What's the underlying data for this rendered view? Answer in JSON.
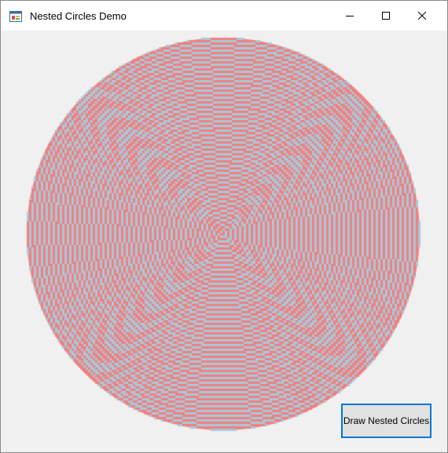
{
  "window": {
    "title": "Nested Circles Demo",
    "controls": {
      "minimize_icon": "minimize-icon",
      "maximize_icon": "maximize-icon",
      "close_icon": "close-icon"
    }
  },
  "toolbar": {
    "draw_button_label": "Draw Nested Circles"
  },
  "colors": {
    "circle_primary": "#f08080",
    "circle_secondary": "#a8c8d8",
    "client_background": "#f0f0f0",
    "button_border": "#0078d7",
    "button_face": "#e1e1e1"
  }
}
